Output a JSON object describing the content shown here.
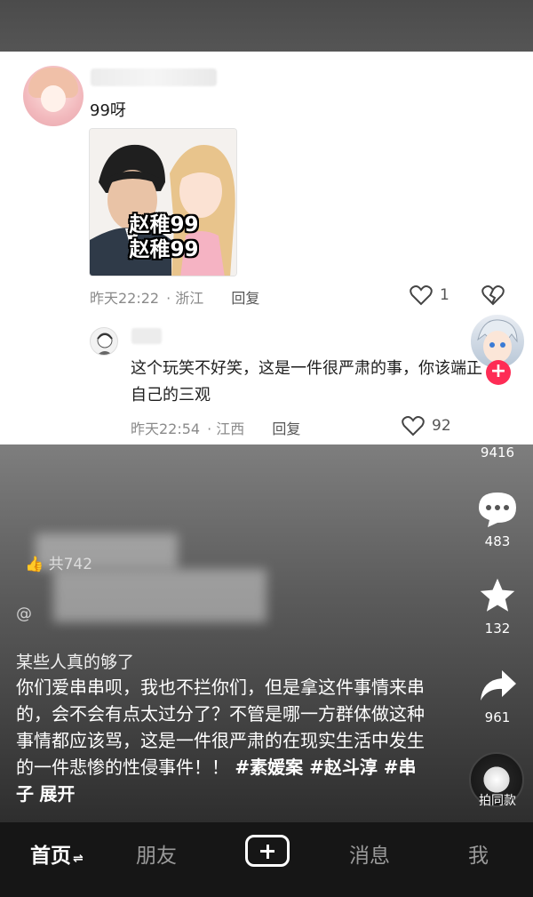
{
  "comment1": {
    "text": "99呀",
    "meme_caption_1": "赵稚99",
    "meme_caption_2": "赵稚99",
    "time": "昨天22:22",
    "location": "浙江",
    "reply_label": "回复",
    "likes": "1"
  },
  "comment2": {
    "text": "这个玩笑不好笑，这是一件很严肃的事，你该端正自己的三观",
    "time": "昨天22:54",
    "location": "江西",
    "reply_label": "回复",
    "likes": "92"
  },
  "post": {
    "likers_prefix": "共742",
    "at_prefix": "@",
    "caption_title": "某些人真的够了",
    "caption_body": "你们爱串串呗，我也不拦你们，但是拿这件事情来串的，会不会有点太过分了？不管是哪一方群体做这种事情都应该骂，这是一件很严肃的在现实生活中发生的一件悲惨的性侵事件！！",
    "hashtags": "#素媛案 #赵斗淳 #串子",
    "expand_label": "展开"
  },
  "side_actions": {
    "like_count": "9416",
    "comment_count": "483",
    "favorite_count": "132",
    "share_count": "961",
    "same_style_label": "拍同款"
  },
  "tabbar": {
    "home": "首页",
    "home_suffix": "⇌",
    "friends": "朋友",
    "messages": "消息",
    "me": "我"
  },
  "colors": {
    "accent": "#fe2c55",
    "tabbar_bg": "#161616"
  }
}
